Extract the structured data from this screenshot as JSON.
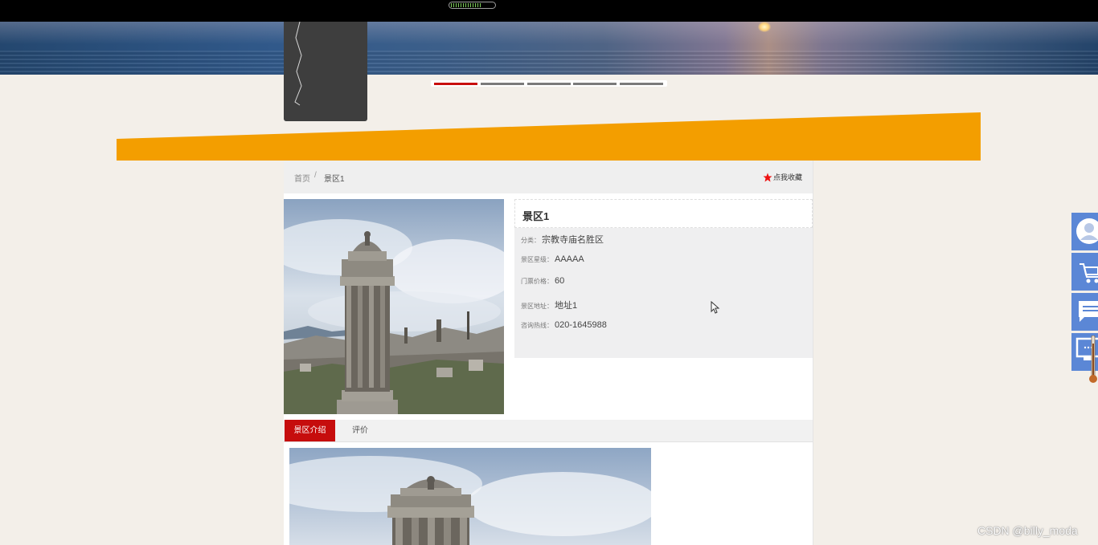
{
  "slider": {
    "dot_count": 5,
    "active_index": 0,
    "active_color": "#c80f0f"
  },
  "accent_colors": {
    "orange": "#f39e00",
    "red": "#c60d0d",
    "side_tool_blue": "#5b87d6"
  },
  "breadcrumb": {
    "home": "首页",
    "separator": "/",
    "current": "景区1"
  },
  "favorite": {
    "label": "点我收藏",
    "icon": "star-icon"
  },
  "spot": {
    "title": "景区1",
    "fields": [
      {
        "label": "分类：",
        "value": "宗教寺庙名胜区"
      },
      {
        "label": "景区星级：",
        "value": "AAAAA"
      },
      {
        "label": "门票价格：",
        "value": "60"
      },
      {
        "label": "景区地址：",
        "value": "地址1"
      },
      {
        "label": "咨询热线：",
        "value": "020-1645988"
      }
    ]
  },
  "tabs": [
    {
      "label": "景区介绍",
      "active": true
    },
    {
      "label": "评价",
      "active": false
    }
  ],
  "side_tools": [
    "user-icon",
    "cart-icon",
    "chat-icon",
    "monitor-icon"
  ],
  "watermark": "CSDN @billy_moda"
}
